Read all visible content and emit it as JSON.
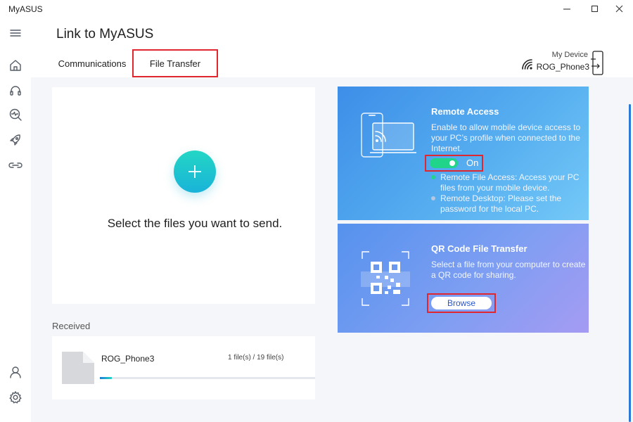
{
  "app": {
    "title": "MyASUS"
  },
  "header": {
    "title": "Link to MyASUS",
    "tabs": [
      {
        "label": "Communications"
      },
      {
        "label": "File Transfer",
        "selected": true
      }
    ],
    "device": {
      "caption": "My Device",
      "name": "ROG_Phone3"
    }
  },
  "sidebar": {
    "items": [
      {
        "icon": "menu-icon"
      },
      {
        "icon": "home-icon"
      },
      {
        "icon": "headset-icon"
      },
      {
        "icon": "diagnostics-icon"
      },
      {
        "icon": "rocket-icon"
      },
      {
        "icon": "link-icon"
      },
      {
        "icon": "user-icon"
      },
      {
        "icon": "gear-icon"
      }
    ]
  },
  "send": {
    "text": "Select the files you want to send."
  },
  "received": {
    "label": "Received",
    "item": {
      "name": "ROG_Phone3",
      "count": "1 file(s) / 19 file(s)",
      "progress": 0.055
    }
  },
  "remote_access": {
    "title": "Remote Access",
    "description": "Enable to allow mobile device access to your PC’s profile when connected to the Internet.",
    "toggle_label": "On",
    "bullets": [
      {
        "text": "Remote File Access: Access your PC files from your mobile device.",
        "active": true
      },
      {
        "text": "Remote Desktop: Please set the password for the local PC.",
        "active": false
      }
    ]
  },
  "qr_transfer": {
    "title": "QR Code File Transfer",
    "description": "Select a file from your computer to create a QR code for sharing.",
    "browse_label": "Browse"
  },
  "colors": {
    "accent_red": "#e0262e",
    "toggle_green": "#20d58a",
    "scroll_blue": "#2b78d6"
  }
}
